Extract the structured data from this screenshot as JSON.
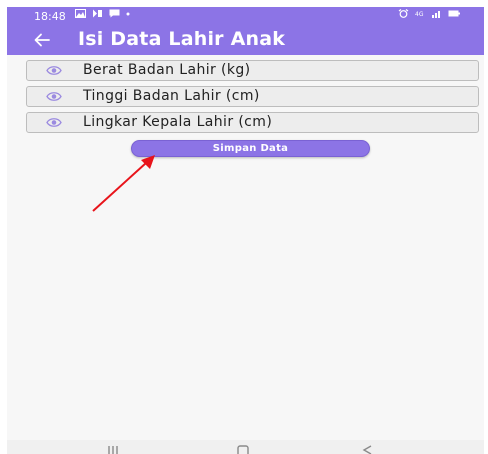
{
  "status_bar": {
    "time": "18:48",
    "left_icons": [
      "gallery-icon",
      "play-icon",
      "message-icon",
      "dot-icon"
    ],
    "right_icons": [
      "alarm-icon",
      "network-icon",
      "signal-icon",
      "battery-icon"
    ]
  },
  "app_bar": {
    "back_icon": "arrow-left-icon",
    "title": "Isi Data Lahir Anak"
  },
  "form": {
    "fields": [
      {
        "icon": "eye-icon",
        "label": "Berat Badan Lahir (kg)"
      },
      {
        "icon": "eye-icon",
        "label": "Tinggi Badan Lahir (cm)"
      },
      {
        "icon": "eye-icon",
        "label": "Lingkar Kepala Lahir (cm)"
      }
    ],
    "save_button_label": "Simpan Data"
  },
  "annotation": {
    "type": "arrow",
    "color": "#e8141b",
    "points_to": "save-button"
  },
  "nav_bar": {
    "icons": [
      "recents-icon",
      "home-icon",
      "back-icon"
    ]
  },
  "colors": {
    "primary": "#8c74e6",
    "field_bg": "#ededed",
    "field_border": "#bdbdbd",
    "eye_icon": "#9b8ae0",
    "page_bg": "#f7f7f7"
  }
}
